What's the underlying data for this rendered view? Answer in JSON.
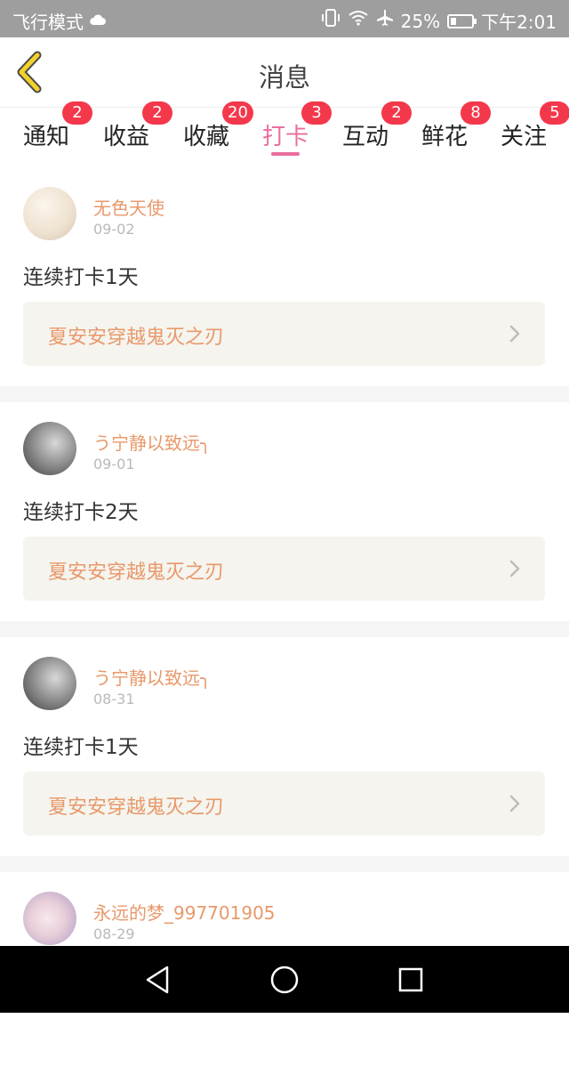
{
  "status_bar": {
    "airplane_mode_text": "飞行模式",
    "battery_percent": "25%",
    "battery_level": 0.25,
    "time": "下午2:01",
    "icons": [
      "cloud-icon",
      "vibrate-icon",
      "wifi-icon",
      "airplane-icon",
      "battery-icon"
    ]
  },
  "header": {
    "title": "消息",
    "back_icon": "chevron-left-icon"
  },
  "tabs": [
    {
      "label": "通知",
      "badge": "2",
      "active": false
    },
    {
      "label": "收益",
      "badge": "2",
      "active": false
    },
    {
      "label": "收藏",
      "badge": "20",
      "active": false
    },
    {
      "label": "打卡",
      "badge": "3",
      "active": true
    },
    {
      "label": "互动",
      "badge": "2",
      "active": false
    },
    {
      "label": "鲜花",
      "badge": "8",
      "active": false
    },
    {
      "label": "关注",
      "badge": "5",
      "active": false
    }
  ],
  "items": [
    {
      "username": "无色天使",
      "date": "09-02",
      "message": "连续打卡1天",
      "book": "夏安安穿越鬼灭之刃"
    },
    {
      "username": "う宁静以致远╮",
      "date": "09-01",
      "message": "连续打卡2天",
      "book": "夏安安穿越鬼灭之刃"
    },
    {
      "username": "う宁静以致远╮",
      "date": "08-31",
      "message": "连续打卡1天",
      "book": "夏安安穿越鬼灭之刃"
    },
    {
      "username": "永远的梦_997701905",
      "date": "08-29"
    }
  ],
  "colors": {
    "accent_pink": "#e86e9e",
    "badge_red": "#f4384c",
    "username_orange": "#e8996b",
    "book_bg": "#f5f4ee",
    "back_icon_yellow": "#f2d22a"
  },
  "nav_bar": {
    "icons": [
      "back-triangle-icon",
      "home-circle-icon",
      "recents-square-icon"
    ]
  }
}
